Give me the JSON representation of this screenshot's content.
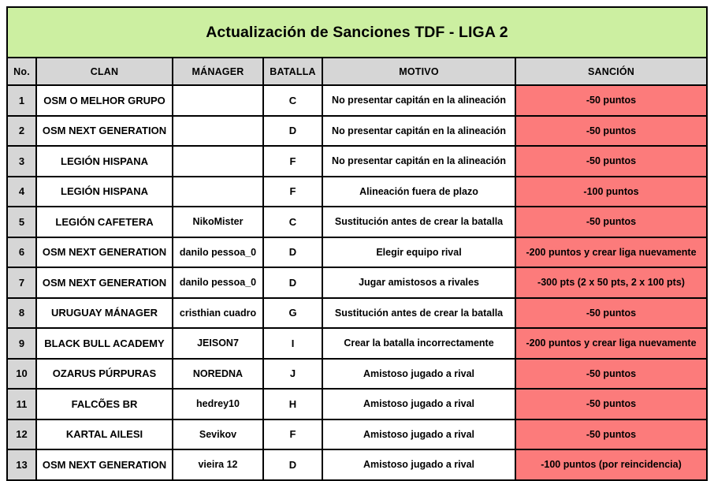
{
  "title": "Actualización de Sanciones TDF - LIGA 2",
  "colors": {
    "title_background": "#CCEFA1",
    "header_background": "#D6D6D6",
    "sanction_background": "#FC7B7B",
    "row_number_background": "#D6D6D6",
    "grid_line": "#000000",
    "text": "#000000"
  },
  "table": {
    "columns": [
      "No.",
      "CLAN",
      "MÁNAGER",
      "BATALLA",
      "MOTIVO",
      "SANCIÓN"
    ],
    "rows": [
      {
        "no": "1",
        "clan": "OSM O MELHOR GRUPO",
        "manager": "",
        "batalla": "C",
        "motivo": "No presentar capitán en la alineación",
        "sancion": "-50 puntos"
      },
      {
        "no": "2",
        "clan": "OSM NEXT GENERATION",
        "manager": "",
        "batalla": "D",
        "motivo": "No presentar capitán en la alineación",
        "sancion": "-50 puntos"
      },
      {
        "no": "3",
        "clan": "LEGIÓN HISPANA",
        "manager": "",
        "batalla": "F",
        "motivo": "No presentar capitán en la alineación",
        "sancion": "-50 puntos"
      },
      {
        "no": "4",
        "clan": "LEGIÓN HISPANA",
        "manager": "",
        "batalla": "F",
        "motivo": "Alineación fuera de plazo",
        "sancion": "-100 puntos"
      },
      {
        "no": "5",
        "clan": "LEGIÓN CAFETERA",
        "manager": "NikoMister",
        "batalla": "C",
        "motivo": "Sustitución antes de crear la batalla",
        "sancion": "-50 puntos"
      },
      {
        "no": "6",
        "clan": "OSM NEXT GENERATION",
        "manager": "danilo pessoa_0",
        "batalla": "D",
        "motivo": "Elegir equipo rival",
        "sancion": "-200 puntos y crear liga nuevamente"
      },
      {
        "no": "7",
        "clan": "OSM NEXT GENERATION",
        "manager": "danilo pessoa_0",
        "batalla": "D",
        "motivo": "Jugar amistosos a rivales",
        "sancion": "-300 pts (2 x 50 pts, 2 x 100 pts)"
      },
      {
        "no": "8",
        "clan": "URUGUAY MÁNAGER",
        "manager": "cristhian cuadro",
        "batalla": "G",
        "motivo": "Sustitución antes de crear la batalla",
        "sancion": "-50 puntos"
      },
      {
        "no": "9",
        "clan": "BLACK BULL ACADEMY",
        "manager": "JEISON7",
        "batalla": "I",
        "motivo": "Crear la batalla incorrectamente",
        "sancion": "-200 puntos y crear liga nuevamente"
      },
      {
        "no": "10",
        "clan": "OZARUS PÚRPURAS",
        "manager": "NOREDNA",
        "batalla": "J",
        "motivo": "Amistoso jugado a rival",
        "sancion": "-50 puntos"
      },
      {
        "no": "11",
        "clan": "FALCÕES BR",
        "manager": "hedrey10",
        "batalla": "H",
        "motivo": "Amistoso jugado a rival",
        "sancion": "-50 puntos"
      },
      {
        "no": "12",
        "clan": "KARTAL AILESI",
        "manager": "Sevikov",
        "batalla": "F",
        "motivo": "Amistoso jugado a rival",
        "sancion": "-50 puntos"
      },
      {
        "no": "13",
        "clan": "OSM NEXT GENERATION",
        "manager": "vieira 12",
        "batalla": "D",
        "motivo": "Amistoso jugado a rival",
        "sancion": "-100 puntos (por reincidencia)"
      }
    ]
  }
}
